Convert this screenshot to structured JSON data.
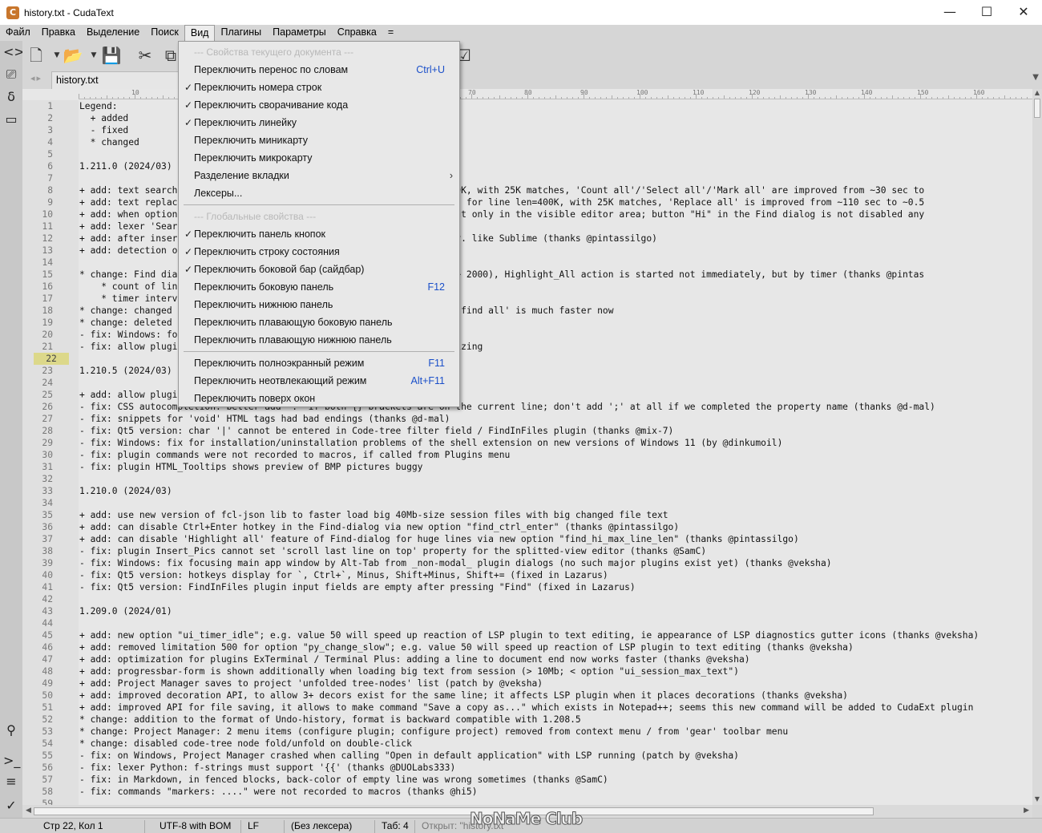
{
  "window": {
    "title": "history.txt - CudaText",
    "app_icon": "C",
    "minimize": "—",
    "maximize": "☐",
    "close": "✕"
  },
  "menubar": [
    "Файл",
    "Правка",
    "Выделение",
    "Поиск",
    "Вид",
    "Плагины",
    "Параметры",
    "Справка",
    "="
  ],
  "active_menu": "Вид",
  "tab": {
    "label": "history.txt"
  },
  "ruler": {
    "labels": [
      "10",
      "20",
      "30",
      "40",
      "50",
      "60",
      "70",
      "80",
      "90",
      "100",
      "110",
      "120",
      "130",
      "140",
      "150",
      "160"
    ]
  },
  "editor": {
    "current_line": 22,
    "lines": [
      "Legend:",
      "  + added",
      "  - fixed",
      "  * changed",
      "",
      "1.211.0 (2024/03)",
      "",
      "+ add: text search                                    for line len=400K, with 25K matches, 'Count all'/'Select all'/'Mark all' are improved from ~30 sec to",
      "+ add: text replac                                    huge lines; e.g. for line len=400K, with 25K matches, 'Replace all' is improved from ~110 sec to ~0.5",
      "+ add: when option                                   t occurrences, but only in the visible editor area; button \"Hi\" in the Find dialog is not disabled any",
      "+ add: lexer 'Sear",
      "+ add: after inser                                   hen make it empty. like Sublime (thanks @pintassilgo)",
      "+ add: detection o",
      "",
      "* change: Find dia                                   (count of lines > 2000), Highlight_All action is started not immediately, but by timer (thanks @pintas",
      "    * count of lin                                   s\":2000",
      "    * timer interv                                   rval\":500",
      "* change: changed                                    o 800k, because 'find all' is much faster now",
      "* change: deleted",
      "- fix: Windows: fo                                   l",
      "- fix: allow plugi                                   so to window resizing",
      "",
      "1.210.5 (2024/03)",
      "",
      "+ add: allow plugi                                   too",
      "- fix: CSS autocompletion: better add ':' if both {} brackets are on the current line; don't add ';' at all if we completed the property name (thanks @d-mal)",
      "- fix: snippets for 'void' HTML tags had bad endings (thanks @d-mal)",
      "- fix: Qt5 version: char '|' cannot be entered in Code-tree filter field / FindInFiles plugin (thanks @mix-7)",
      "- fix: Windows: fix for installation/uninstallation problems of the shell extension on new versions of Windows 11 (by @dinkumoil)",
      "- fix: plugin commands were not recorded to macros, if called from Plugins menu",
      "- fix: plugin HTML_Tooltips shows preview of BMP pictures buggy",
      "",
      "1.210.0 (2024/03)",
      "",
      "+ add: use new version of fcl-json lib to faster load big 40Mb-size session files with big changed file text",
      "+ add: can disable Ctrl+Enter hotkey in the Find-dialog via new option \"find_ctrl_enter\" (thanks @pintassilgo)",
      "+ add: can disable 'Highlight all' feature of Find-dialog for huge lines via new option \"find_hi_max_line_len\" (thanks @pintassilgo)",
      "- fix: plugin Insert_Pics cannot set 'scroll last line on top' property for the splitted-view editor (thanks @SamC)",
      "- fix: Windows: fix focusing main app window by Alt-Tab from _non-modal_ plugin dialogs (no such major plugins exist yet) (thanks @veksha)",
      "- fix: Qt5 version: hotkeys display for `, Ctrl+`, Minus, Shift+Minus, Shift+= (fixed in Lazarus)",
      "- fix: Qt5 version: FindInFiles plugin input fields are empty after pressing \"Find\" (fixed in Lazarus)",
      "",
      "1.209.0 (2024/01)",
      "",
      "+ add: new option \"ui_timer_idle\"; e.g. value 50 will speed up reaction of LSP plugin to text editing, ie appearance of LSP diagnostics gutter icons (thanks @veksha)",
      "+ add: removed limitation 500 for option \"py_change_slow\"; e.g. value 50 will speed up reaction of LSP plugin to text editing (thanks @veksha)",
      "+ add: optimization for plugins ExTerminal / Terminal Plus: adding a line to document end now works faster (thanks @veksha)",
      "+ add: progressbar-form is shown additionally when loading big text from session (> 10Mb; < option \"ui_session_max_text\")",
      "+ add: Project Manager saves to project 'unfolded tree-nodes' list (patch by @veksha)",
      "+ add: improved decoration API, to allow 3+ decors exist for the same line; it affects LSP plugin when it places decorations (thanks @veksha)",
      "+ add: improved API for file saving, it allows to make command \"Save a copy as...\" which exists in Notepad++; seems this new command will be added to CudaExt plugin",
      "* change: addition to the format of Undo-history, format is backward compatible with 1.208.5",
      "* change: Project Manager: 2 menu items (configure plugin; configure project) removed from context menu / from 'gear' toolbar menu",
      "* change: disabled code-tree node fold/unfold on double-click",
      "- fix: on Windows, Project Manager crashed when calling \"Open in default application\" with LSP running (patch by @veksha)",
      "- fix: lexer Python: f-strings must support '{{' (thanks @DUOLabs333)",
      "- fix: in Markdown, in fenced blocks, back-color of empty line was wrong sometimes (thanks @SamC)",
      "- fix: commands \"markers: ....\" were not recorded to macros (thanks @hi5)",
      ""
    ]
  },
  "dropdown": {
    "items": [
      {
        "type": "section",
        "label": "--- Свойства текущего документа ---"
      },
      {
        "type": "item",
        "label": "Переключить перенос по словам",
        "shortcut": "Ctrl+U",
        "checked": false
      },
      {
        "type": "item",
        "label": "Переключить номера строк",
        "shortcut": "",
        "checked": true
      },
      {
        "type": "item",
        "label": "Переключить сворачивание кода",
        "shortcut": "",
        "checked": true
      },
      {
        "type": "item",
        "label": "Переключить линейку",
        "shortcut": "",
        "checked": true
      },
      {
        "type": "item",
        "label": "Переключить миникарту",
        "shortcut": "",
        "checked": false
      },
      {
        "type": "item",
        "label": "Переключить микрокарту",
        "shortcut": "",
        "checked": false
      },
      {
        "type": "submenu",
        "label": "Разделение вкладки",
        "arrow": "›"
      },
      {
        "type": "item",
        "label": "Лексеры...",
        "shortcut": "",
        "checked": false
      },
      {
        "type": "sep"
      },
      {
        "type": "section",
        "label": "--- Глобальные свойства ---"
      },
      {
        "type": "item",
        "label": "Переключить панель кнопок",
        "shortcut": "",
        "checked": true
      },
      {
        "type": "item",
        "label": "Переключить строку состояния",
        "shortcut": "",
        "checked": true
      },
      {
        "type": "item",
        "label": "Переключить боковой бар (сайдбар)",
        "shortcut": "",
        "checked": true
      },
      {
        "type": "item",
        "label": "Переключить боковую панель",
        "shortcut": "F12",
        "checked": false
      },
      {
        "type": "item",
        "label": "Переключить нижнюю панель",
        "shortcut": "",
        "checked": false
      },
      {
        "type": "item",
        "label": "Переключить плавающую боковую панель",
        "shortcut": "",
        "checked": false
      },
      {
        "type": "item",
        "label": "Переключить плавающую нижнюю панель",
        "shortcut": "",
        "checked": false
      },
      {
        "type": "sep"
      },
      {
        "type": "item",
        "label": "Переключить полноэкранный режим",
        "shortcut": "F11",
        "checked": false
      },
      {
        "type": "item",
        "label": "Переключить неотвлекающий режим",
        "shortcut": "Alt+F11",
        "checked": false
      },
      {
        "type": "item",
        "label": "Переключить поверх окон",
        "shortcut": "",
        "checked": false
      }
    ],
    "check_mark": "✓"
  },
  "statusbar": {
    "position": "Стр 22, Кол 1",
    "encoding": "UTF-8 with BOM",
    "line_ending": "LF",
    "lexer": "(Без лексера)",
    "tab": "Таб: 4",
    "message": "Открыт: \"history.txt\""
  },
  "watermark": "NoNaMe Club",
  "icons": {
    "sidebar": [
      "code-tree-icon",
      "project-icon",
      "snippets-icon",
      "tabs-icon",
      "search-icon",
      "console-icon",
      "list-icon",
      "validate-icon"
    ],
    "toolbar": [
      "new-file-icon",
      "open-file-icon",
      "save-icon",
      "cut-icon",
      "copy-icon",
      "checkbox-icon"
    ]
  },
  "colors": {
    "current_line_gutter": "#dcd88a",
    "shortcut_blue": "#1a4fc9",
    "editor_bg": "#e7e7e7"
  }
}
